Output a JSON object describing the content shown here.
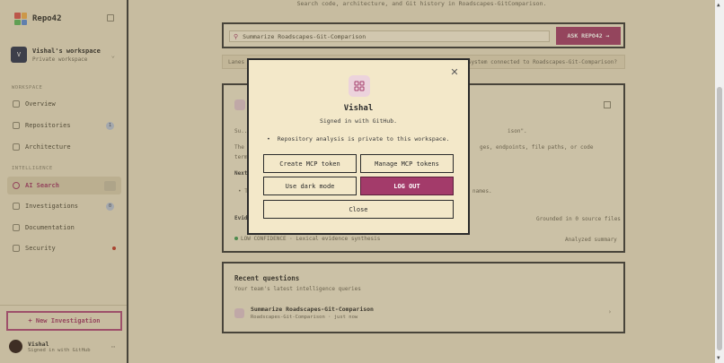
{
  "brand": {
    "name": "Repo42"
  },
  "workspace": {
    "name": "Vishal's workspace",
    "subtitle": "Private workspace",
    "initial": "V"
  },
  "sidebar": {
    "workspace_label": "WORKSPACE",
    "intelligence_label": "INTELLIGENCE",
    "items": [
      {
        "label": "Overview"
      },
      {
        "label": "Repositories",
        "badge": "1"
      },
      {
        "label": "Architecture"
      },
      {
        "label": "AI Search",
        "active": true
      },
      {
        "label": "Investigations",
        "badge": "0"
      },
      {
        "label": "Documentation"
      },
      {
        "label": "Security"
      }
    ],
    "new_investigation": "+ New Investigation",
    "user": {
      "name": "Vishal",
      "subtitle": "Signed in with GitHub"
    }
  },
  "main": {
    "subtitle": "Search code, architecture, and Git history in Roadscapes-GitComparison.",
    "search_value": "Summarize Roadscapes-Git-Comparison",
    "ask_button": "ASK REPO42 →",
    "hint_left": "Lanes",
    "hint_right": "System connected to Roadscapes-Git-Comparison?",
    "panel1": {
      "line1": "Su...",
      "line1_right": "ison\".",
      "line2": "The",
      "line2_right": "ges, endpoints, file paths, or code",
      "line3": "terms",
      "heading": "Next",
      "bullet": "• T",
      "bullet_right": "names.",
      "evidence": "Evid",
      "grounded": "Grounded in 0 source files",
      "confidence": "LOW CONFIDENCE · Lexical evidence synthesis",
      "analyzed": "Analyzed summary"
    },
    "panel2": {
      "title": "Recent questions",
      "subtitle": "Your team's latest intelligence queries",
      "question": "Summarize Roadscapes-Git-Comparison",
      "meta": "Roadscapes-Git-Comparison · just now"
    }
  },
  "modal": {
    "title": "Vishal",
    "subtitle": "Signed in with GitHub.",
    "bullet": "Repository analysis is private to this workspace.",
    "buttons": {
      "create_token": "Create MCP token",
      "manage_tokens": "Manage MCP tokens",
      "dark_mode": "Use dark mode",
      "logout": "LOG OUT",
      "close": "Close"
    }
  },
  "colors": {
    "accent": "#a33b6a",
    "background": "#e9dfc6",
    "modal_bg": "#f3e8c9",
    "border": "#2b2b2b"
  },
  "icons": [
    "logo-icon",
    "collapse-sidebar-icon",
    "workspace-chevron-icon",
    "overview-icon",
    "repositories-icon",
    "architecture-icon",
    "search-icon",
    "investigations-icon",
    "documentation-icon",
    "security-icon",
    "user-more-icon",
    "close-icon",
    "grid-icon",
    "copy-icon",
    "arrow-right-icon"
  ]
}
